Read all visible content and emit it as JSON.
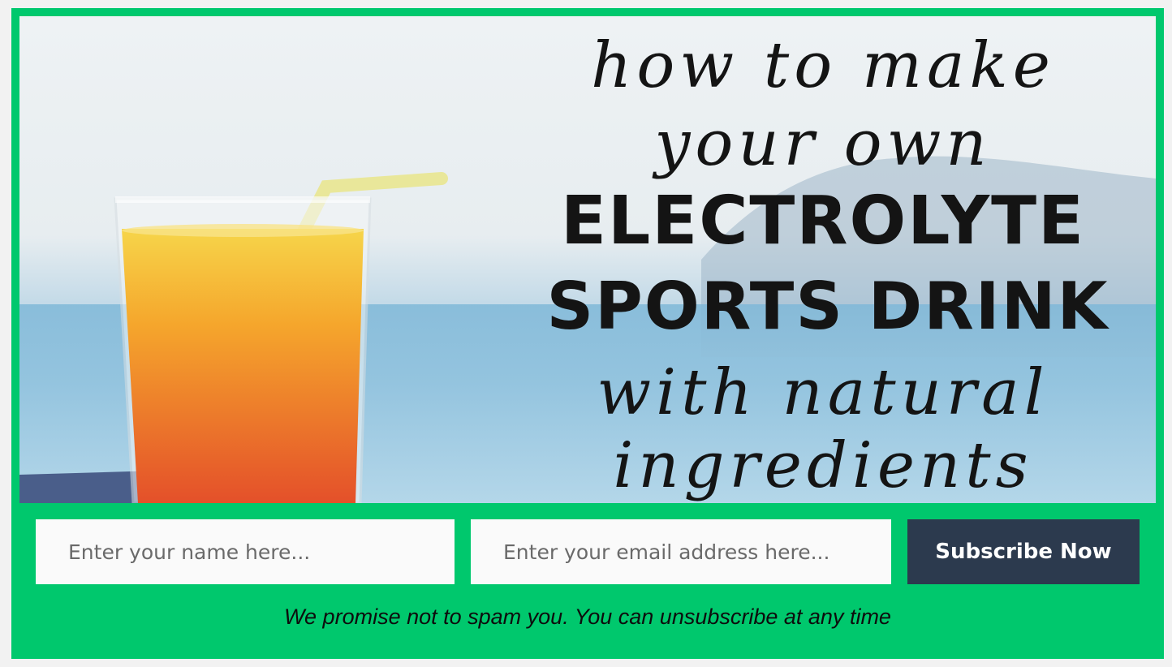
{
  "banner": {
    "line1": "how to make",
    "line2": "your own",
    "line3": "ELECTROLYTE",
    "line4": "SPORTS DRINK",
    "line5": "with natural",
    "line6": "ingredients"
  },
  "form": {
    "name_placeholder": "Enter your name here...",
    "email_placeholder": "Enter your email address here...",
    "submit_label": "Subscribe Now",
    "disclaimer": "We promise not to spam you. You can unsubscribe at any time"
  },
  "colors": {
    "frame": "#00c86d",
    "button": "#2c3a4e"
  }
}
